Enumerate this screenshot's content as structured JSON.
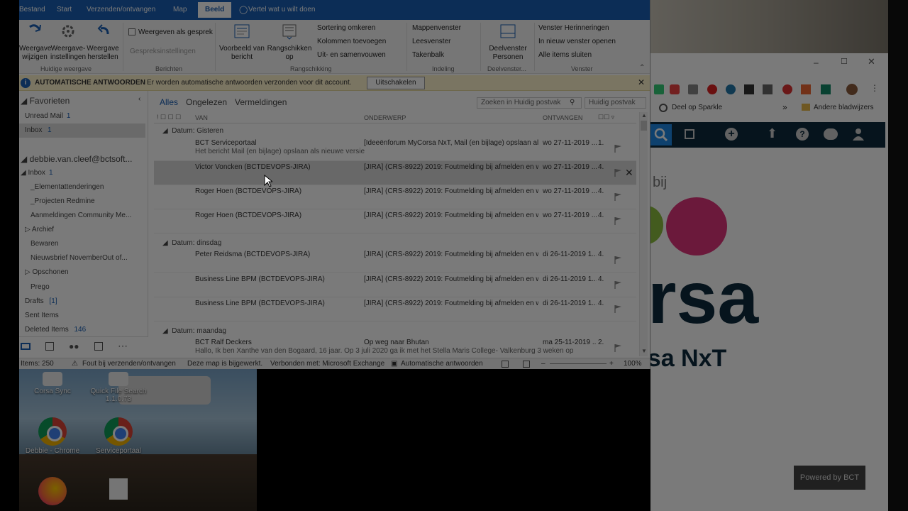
{
  "menu": {
    "tabs": [
      "Bestand",
      "Start",
      "Verzenden/ontvangen",
      "Map",
      "Beeld"
    ],
    "active": "Beeld",
    "tellme": "Vertel wat u wilt doen"
  },
  "ribbon": {
    "btn_change_view": "Weergave wijzigen",
    "btn_view_settings": "Weergave-instellingen",
    "btn_reset_view": "Weergave herstellen",
    "group_current_view": "Huidige weergave",
    "chk_show_conversation": "Weergeven als gesprek",
    "conversation_settings": "Gespreksinstellingen",
    "group_messages": "Berichten",
    "btn_preview": "Voorbeeld van bericht",
    "btn_arrange": "Rangschikken op",
    "reverse_sort": "Sortering omkeren",
    "add_columns": "Kolommen toevoegen",
    "expand_collapse": "Uit- en samenvouwen",
    "group_arrangement": "Rangschikking",
    "folder_pane": "Mappenvenster",
    "reading_pane": "Leesvenster",
    "todo_bar": "Takenbalk",
    "group_layout": "Indeling",
    "btn_people_pane": "Deelvenster Personen",
    "group_people": "Deelvenster...",
    "reminders": "Venster Herinneringen",
    "open_new_window": "In nieuw venster openen",
    "close_all": "Alle items sluiten",
    "group_window": "Venster"
  },
  "infobar": {
    "title": "AUTOMATISCHE ANTWOORDEN",
    "message": "Er worden automatische antwoorden verzonden voor dit account.",
    "button": "Uitschakelen"
  },
  "folders": {
    "favorites_label": "Favorieten",
    "unread_mail": "Unread Mail",
    "unread_count": "1",
    "inbox_fav": "Inbox",
    "inbox_fav_count": "1",
    "account": "debbie.van.cleef@bctsoft...",
    "inbox": "Inbox",
    "inbox_count": "1",
    "items": [
      "_Elementattenderingen",
      "_Projecten Redmine",
      "Aanmeldingen Community Me...",
      "Archief",
      "Bewaren",
      "Nieuwsbrief NovemberOut of...",
      "Opschonen",
      "Prego"
    ],
    "drafts": "Drafts",
    "drafts_count": "[1]",
    "sent": "Sent Items",
    "deleted": "Deleted Items",
    "deleted_count": "146"
  },
  "list": {
    "filters": [
      "Alles",
      "Ongelezen",
      "Vermeldingen"
    ],
    "search_placeholder": "Zoeken in Huidig postvak",
    "scope": "Huidig postvak",
    "col_from": "VAN",
    "col_subject": "ONDERWERP",
    "col_received": "ONTVANGEN",
    "groups": [
      "Datum: Gisteren",
      "Datum: dinsdag",
      "Datum: maandag"
    ],
    "rows": [
      {
        "from": "BCT Serviceportaal",
        "subject": "[Ideeënforum MyCorsa NxT, Mail (en bijlage) opslaan als...",
        "received": "wo 27-11-2019 ...",
        "size": "1.",
        "preview": "Het bericht Mail (en bijlage) opslaan als nieuwe versie"
      },
      {
        "from": "Victor Voncken (BCTDEVOPS-JIRA)",
        "subject": "[JIRA] (CRS-8922) 2019: Foutmelding bij afmelden en we...",
        "received": "wo 27-11-2019 ...",
        "size": "4.",
        "preview": ""
      },
      {
        "from": "Roger Hoen (BCTDEVOPS-JIRA)",
        "subject": "[JIRA] (CRS-8922) 2019: Foutmelding bij afmelden en we...",
        "received": "wo 27-11-2019 ...",
        "size": "4.",
        "preview": ""
      },
      {
        "from": "Roger Hoen (BCTDEVOPS-JIRA)",
        "subject": "[JIRA] (CRS-8922) 2019: Foutmelding bij afmelden en we...",
        "received": "wo 27-11-2019 ...",
        "size": "4.",
        "preview": ""
      },
      {
        "from": "Peter Reidsma (BCTDEVOPS-JIRA)",
        "subject": "[JIRA] (CRS-8922) 2019: Foutmelding bij afmelden en we...",
        "received": "di 26-11-2019 1...",
        "size": "4.",
        "preview": ""
      },
      {
        "from": "Business Line BPM (BCTDEVOPS-JIRA)",
        "subject": "[JIRA] (CRS-8922) 2019: Foutmelding bij afmelden en we...",
        "received": "di 26-11-2019 1...",
        "size": "4.",
        "preview": ""
      },
      {
        "from": "Business Line BPM (BCTDEVOPS-JIRA)",
        "subject": "[JIRA] (CRS-8922) 2019: Foutmelding bij afmelden en we...",
        "received": "di 26-11-2019 1...",
        "size": "4.",
        "preview": ""
      },
      {
        "from": "BCT Ralf Deckers",
        "subject": "Op weg naar Bhutan",
        "received": "ma 25-11-2019 ...",
        "size": "2.",
        "preview": "Hallo, Ik ben Xanthe van den Bogaard, 16 jaar. Op 3 juli 2020 ga ik met het Stella Maris College- Valkenburg 3 weken op"
      }
    ]
  },
  "status": {
    "items": "Items: 250",
    "error": "Fout bij verzenden/ontvangen",
    "folder_updated": "Deze map is bijgewerkt.",
    "connected": "Verbonden met: Microsoft Exchange",
    "auto_reply": "Automatische antwoorden",
    "zoom": "100%"
  },
  "desktop": {
    "icons": [
      "Corsa Sync",
      "Quick File Search 1.1.0.73",
      "Debbie - Chrome",
      "Serviceportaal"
    ]
  },
  "browser": {
    "tab_text": "Deel op Sparkle",
    "bookmarks_other": "Andere bladwijzers",
    "bij": "bij",
    "brand_big": "rsa",
    "brand_small": "MyCorsa NxT",
    "powered": "Powered by BCT"
  },
  "colors": {
    "outlook_blue": "#1a5fb4",
    "browser_navbar": "#0d2a3d",
    "infobar_bg": "#fff4ce"
  }
}
